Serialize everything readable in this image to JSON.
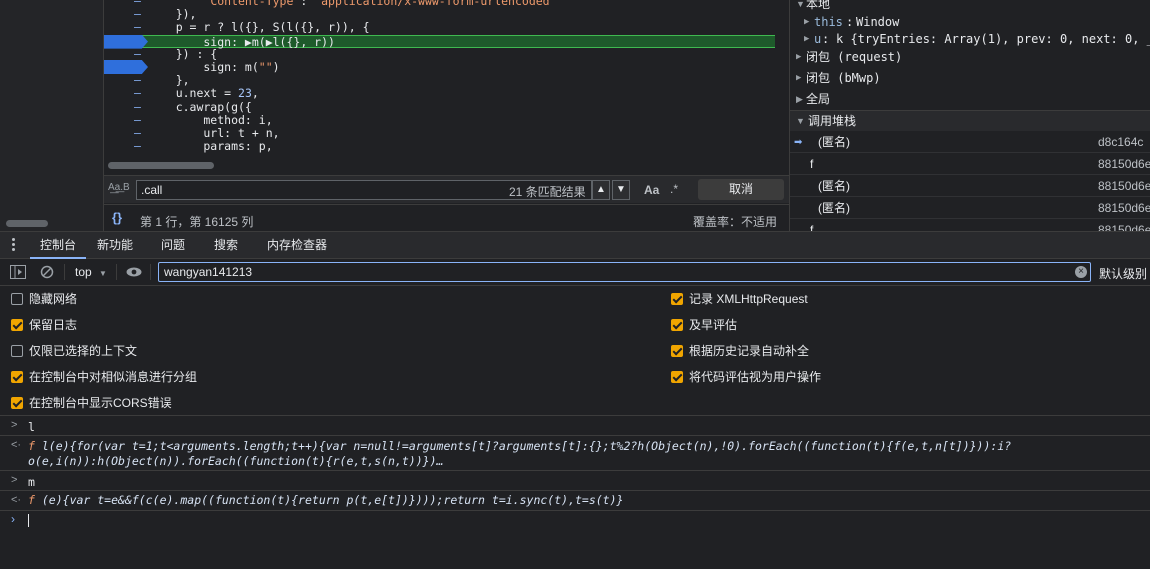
{
  "editor": {
    "lines": [
      {
        "text": "        \"Content-Type\": \"application/x-www-form-urlencoded\"",
        "highlight": false,
        "breakpoint": false
      },
      {
        "text": "    }),",
        "highlight": false,
        "breakpoint": false
      },
      {
        "text": "    p = r ? l({}, S(l({}, r)), {",
        "highlight": false,
        "breakpoint": false
      },
      {
        "text": "        sign: ▶m(▶l({}, r))",
        "highlight": true,
        "breakpoint": true
      },
      {
        "text": "    }) : {",
        "highlight": false,
        "breakpoint": false
      },
      {
        "text": "        sign: m(\"\")",
        "highlight": false,
        "breakpoint": true
      },
      {
        "text": "    },",
        "highlight": false,
        "breakpoint": false
      },
      {
        "text": "    u.next = 23,",
        "highlight": false,
        "breakpoint": false
      },
      {
        "text": "    c.awrap(g({",
        "highlight": false,
        "breakpoint": false
      },
      {
        "text": "        method: i,",
        "highlight": false,
        "breakpoint": false
      },
      {
        "text": "        url: t + n,",
        "highlight": false,
        "breakpoint": false
      },
      {
        "text": "        params: p,",
        "highlight": false,
        "breakpoint": false
      }
    ]
  },
  "search": {
    "aa_label": "A͟a͟.B",
    "query": ".call",
    "match_count": "21 条匹配结果",
    "up_icon": "chevron-up-icon",
    "down_icon": "chevron-down-icon",
    "case_label": "Aa",
    "regex_label": ".*",
    "cancel_label": "取消"
  },
  "status": {
    "braces": "{}",
    "position": "第 1 行，第 16125 列",
    "coverage": "覆盖率：不适用"
  },
  "scope": {
    "local_label": "本地",
    "this_key": "this",
    "this_val": "Window",
    "u_key": "u",
    "u_val": "k {tryEntries: Array(1), prev: 0, next: 0, _",
    "closure_request": "闭包 (request)",
    "closure_bmwp": "闭包 (bMwp)",
    "global_label": "全局"
  },
  "callstack": {
    "title": "调用堆栈",
    "frames": [
      {
        "name": "(匿名)",
        "loc": "d8c164c",
        "current": true
      },
      {
        "name": "f",
        "loc": "88150d6e",
        "current": false
      },
      {
        "name": "(匿名)",
        "loc": "88150d6e",
        "current": false
      },
      {
        "name": "(匿名)",
        "loc": "88150d6e",
        "current": false
      },
      {
        "name": "f",
        "loc": "88150d6e",
        "current": false
      }
    ]
  },
  "tabs": [
    {
      "label": "控制台",
      "active": true
    },
    {
      "label": "新功能",
      "active": false
    },
    {
      "label": "问题",
      "active": false
    },
    {
      "label": "搜索",
      "active": false
    },
    {
      "label": "内存检查器",
      "active": false
    }
  ],
  "console_toolbar": {
    "context": "top",
    "filter_value": "wangyan141213",
    "level_label": "默认级别"
  },
  "settings": {
    "left": [
      {
        "label": "隐藏网络",
        "checked": false
      },
      {
        "label": "保留日志",
        "checked": true
      },
      {
        "label": "仅限已选择的上下文",
        "checked": false
      },
      {
        "label": "在控制台中对相似消息进行分组",
        "checked": true
      },
      {
        "label": "在控制台中显示CORS错误",
        "checked": true
      }
    ],
    "right": [
      {
        "label": "记录 XMLHttpRequest",
        "checked": true
      },
      {
        "label": "及早评估",
        "checked": true
      },
      {
        "label": "根据历史记录自动补全",
        "checked": true
      },
      {
        "label": "将代码评估视为用户操作",
        "checked": true
      }
    ]
  },
  "log": [
    {
      "input": "l",
      "output": "l(e){for(var t=1;t<arguments.length;t++){var n=null!=arguments[t]?arguments[t]:{};t%2?h(Object(n),!0).forEach((function(t){f(e,t,n[t])})):i?o(e,i(n)):h(Object(n)).forEach((function(t){r(e,t,s(n,t))})…"
    },
    {
      "input": "m",
      "output": "(e){var t=e&&f(c(e).map((function(t){return p(t,e[t])})));return t=i.sync(t),t=s(t)}"
    }
  ],
  "log_fn_prefix": "f",
  "prompt_symbol": "›",
  "output_symbol": "‹·",
  "colors": {
    "accent": "#8ab4f8",
    "checkbox": "#f0a500",
    "highlight_line": "#1e5a2b",
    "breakpoint": "#2f6fdc"
  }
}
